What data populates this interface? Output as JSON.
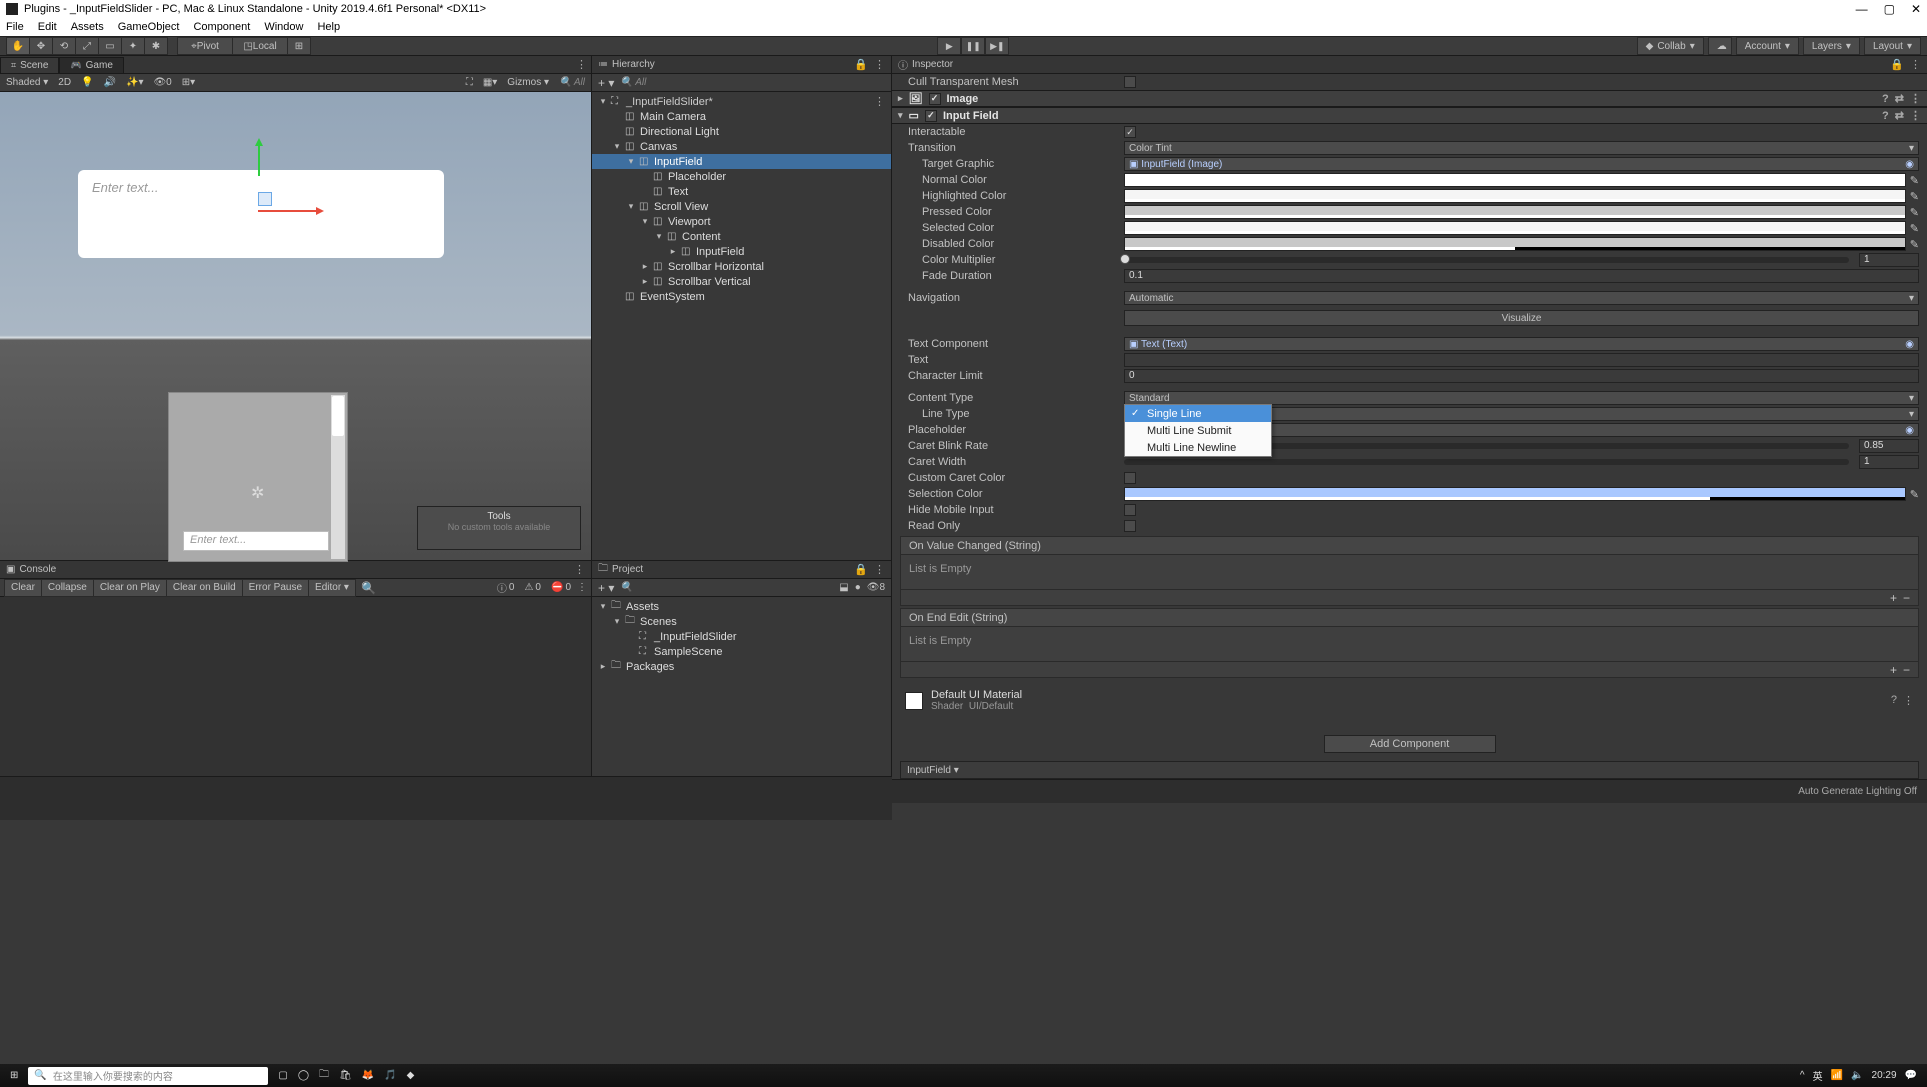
{
  "window": {
    "title": "Plugins - _InputFieldSlider - PC, Mac & Linux Standalone - Unity 2019.4.6f1 Personal* <DX11>"
  },
  "menubar": [
    "File",
    "Edit",
    "Assets",
    "GameObject",
    "Component",
    "Window",
    "Help"
  ],
  "toolbar": {
    "pivot": "Pivot",
    "local": "Local",
    "collab": "Collab",
    "account": "Account",
    "layers": "Layers",
    "layout": "Layout"
  },
  "scene": {
    "tabs": [
      {
        "icon": "⌗",
        "label": "Scene"
      },
      {
        "icon": "🎮",
        "label": "Game"
      }
    ],
    "opts_left": {
      "shaded": "Shaded",
      "twod": "2D",
      "gizmos": "Gizmos"
    },
    "opts_all": "All",
    "placeholder": "Enter text...",
    "tools_title": "Tools",
    "tools_sub": "No custom tools available",
    "game_placeholder": "Enter text..."
  },
  "hierarchy": {
    "title": "Hierarchy",
    "search": "All",
    "items": [
      {
        "indent": 0,
        "tw": "▾",
        "icon": "⛶",
        "label": "_InputFieldSlider*",
        "head": true,
        "more": true
      },
      {
        "indent": 1,
        "tw": "",
        "icon": "◫",
        "label": "Main Camera"
      },
      {
        "indent": 1,
        "tw": "",
        "icon": "◫",
        "label": "Directional Light"
      },
      {
        "indent": 1,
        "tw": "▾",
        "icon": "◫",
        "label": "Canvas"
      },
      {
        "indent": 2,
        "tw": "▾",
        "icon": "◫",
        "label": "InputField",
        "sel": true
      },
      {
        "indent": 3,
        "tw": "",
        "icon": "◫",
        "label": "Placeholder"
      },
      {
        "indent": 3,
        "tw": "",
        "icon": "◫",
        "label": "Text"
      },
      {
        "indent": 2,
        "tw": "▾",
        "icon": "◫",
        "label": "Scroll View"
      },
      {
        "indent": 3,
        "tw": "▾",
        "icon": "◫",
        "label": "Viewport"
      },
      {
        "indent": 4,
        "tw": "▾",
        "icon": "◫",
        "label": "Content"
      },
      {
        "indent": 5,
        "tw": "▸",
        "icon": "◫",
        "label": "InputField"
      },
      {
        "indent": 3,
        "tw": "▸",
        "icon": "◫",
        "label": "Scrollbar Horizontal"
      },
      {
        "indent": 3,
        "tw": "▸",
        "icon": "◫",
        "label": "Scrollbar Vertical"
      },
      {
        "indent": 1,
        "tw": "",
        "icon": "◫",
        "label": "EventSystem"
      }
    ]
  },
  "project": {
    "title": "Project",
    "badges": {
      "hidden": "8"
    },
    "items": [
      {
        "indent": 0,
        "tw": "▾",
        "icon": "🗀",
        "label": "Assets"
      },
      {
        "indent": 1,
        "tw": "▾",
        "icon": "🗀",
        "label": "Scenes"
      },
      {
        "indent": 2,
        "tw": "",
        "icon": "⛶",
        "label": "_InputFieldSlider"
      },
      {
        "indent": 2,
        "tw": "",
        "icon": "⛶",
        "label": "SampleScene"
      },
      {
        "indent": 0,
        "tw": "▸",
        "icon": "🗀",
        "label": "Packages"
      }
    ]
  },
  "console": {
    "title": "Console",
    "btns": [
      "Clear",
      "Collapse",
      "Clear on Play",
      "Clear on Build",
      "Error Pause",
      "Editor ▾"
    ],
    "counts": {
      "info": "0",
      "warn": "0",
      "err": "0"
    }
  },
  "inspector": {
    "title": "Inspector",
    "cull": "Cull Transparent Mesh",
    "image": "Image",
    "inputfield": "Input Field",
    "rows": {
      "interactable": "Interactable",
      "transition": "Transition",
      "transition_val": "Color Tint",
      "target_graphic": "Target Graphic",
      "target_graphic_val": "InputField (Image)",
      "normal": "Normal Color",
      "highlighted": "Highlighted Color",
      "pressed": "Pressed Color",
      "selected": "Selected Color",
      "disabled": "Disabled Color",
      "color_mult": "Color Multiplier",
      "color_mult_val": "1",
      "fade": "Fade Duration",
      "fade_val": "0.1",
      "nav": "Navigation",
      "nav_val": "Automatic",
      "visualize": "Visualize",
      "text_comp": "Text Component",
      "text_comp_val": "Text (Text)",
      "text": "Text",
      "char_limit": "Character Limit",
      "char_limit_val": "0",
      "content_type": "Content Type",
      "content_type_val": "Standard",
      "line_type": "Line Type",
      "line_type_val": "Single Line",
      "placeholder": "Placeholder",
      "caret_blink": "Caret Blink Rate",
      "caret_blink_val": "0.85",
      "caret_width": "Caret Width",
      "caret_width_val": "1",
      "custom_caret": "Custom Caret Color",
      "sel_color": "Selection Color",
      "hide_mobile": "Hide Mobile Input",
      "read_only": "Read Only"
    },
    "line_type_opts": [
      "Single Line",
      "Multi Line Submit",
      "Multi Line Newline"
    ],
    "evt1": "On Value Changed (String)",
    "evt2": "On End Edit (String)",
    "list_empty": "List is Empty",
    "material": "Default UI Material",
    "shader_lab": "Shader",
    "shader_val": "UI/Default",
    "add_comp": "Add Component",
    "asset_btn": "InputField ▾",
    "footer": "Auto Generate Lighting Off"
  },
  "osbar": {
    "search_placeholder": "在这里输入你要搜索的内容",
    "time": "20:29"
  }
}
